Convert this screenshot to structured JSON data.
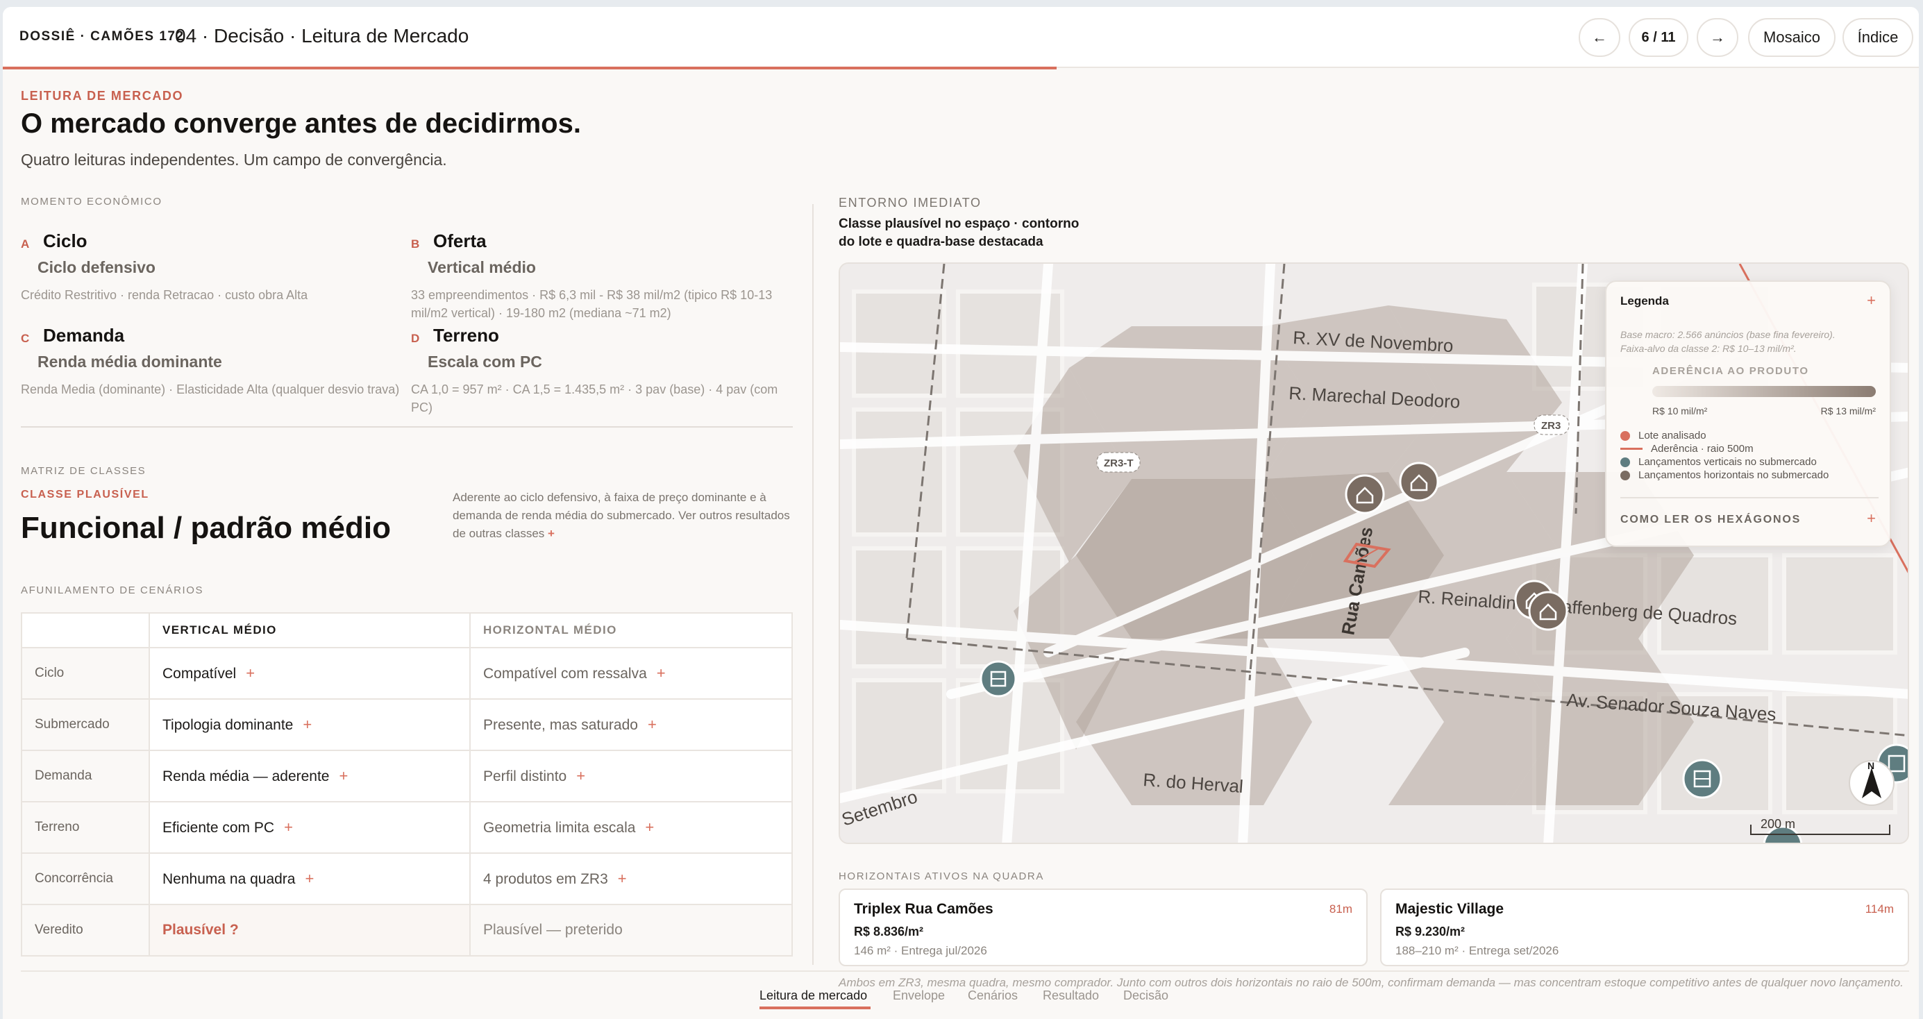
{
  "header": {
    "dossier": "DOSSIÊ · CAMÕES 172",
    "breadcrumb": "04 · Decisão · Leitura de Mercado",
    "prev": "←",
    "page": "6 / 11",
    "next": "→",
    "mosaic": "Mosaico",
    "index": "Índice",
    "progress": 0.55
  },
  "intro": {
    "eyebrow": "LEITURA DE MERCADO",
    "title": "O mercado converge antes de decidirmos.",
    "subtitle": "Quatro leituras independentes. Um campo de convergência."
  },
  "momento": {
    "label": "MOMENTO ECONÔMICO",
    "items": [
      {
        "letter": "A",
        "title": "Ciclo",
        "sub": "Ciclo defensivo",
        "desc": "Crédito Restritivo · renda Retracao · custo obra Alta"
      },
      {
        "letter": "B",
        "title": "Oferta",
        "sub": "Vertical médio",
        "desc": "33 empreendimentos · R$ 6,3 mil - R$ 38 mil/m2 (tipico R$ 10-13 mil/m2 vertical) · 19-180 m2 (mediana ~71 m2)"
      },
      {
        "letter": "C",
        "title": "Demanda",
        "sub": "Renda média dominante",
        "desc": "Renda Media (dominante) · Elasticidade Alta (qualquer desvio trava)"
      },
      {
        "letter": "D",
        "title": "Terreno",
        "sub": "Escala com PC",
        "desc": "CA 1,0 = 957 m² · CA 1,5 = 1.435,5 m² · 3 pav (base) · 4 pav (com PC)"
      }
    ]
  },
  "matriz": {
    "label": "MATRIZ DE CLASSES",
    "eyebrow": "CLASSE PLAUSÍVEL",
    "class_name": "Funcional / padrão médio",
    "note": "Aderente ao ciclo defensivo, à faixa de preço dominante e à demanda de renda média do submercado. Ver outros resultados de outras classes",
    "note_plus": "+"
  },
  "cenarios": {
    "label": "AFUNILAMENTO DE CENÁRIOS",
    "columns": [
      "",
      "VERTICAL MÉDIO",
      "HORIZONTAL MÉDIO"
    ],
    "plus": "+",
    "rows": [
      {
        "label": "Ciclo",
        "v": "Compatível",
        "h": "Compatível com ressalva"
      },
      {
        "label": "Submercado",
        "v": "Tipologia dominante",
        "h": "Presente, mas saturado"
      },
      {
        "label": "Demanda",
        "v": "Renda média — aderente",
        "h": "Perfil distinto"
      },
      {
        "label": "Terreno",
        "v": "Eficiente com PC",
        "h": "Geometria limita escala"
      },
      {
        "label": "Concorrência",
        "v": "Nenhuma na quadra",
        "h": "4 produtos em ZR3"
      },
      {
        "label": "Veredito",
        "v": "Plausível ?",
        "h": "Plausível — preterido"
      }
    ]
  },
  "entorno": {
    "label": "ENTORNO IMEDIATO",
    "caption_1": "Classe plausível no espaço · contorno",
    "caption_2": "do lote e quadra-base destacada"
  },
  "map": {
    "streets": {
      "xv": "R. XV de Novembro",
      "marechal": "R. Marechal Deodoro",
      "camoes": "Rua Camões",
      "reinaldino": "R. Reinaldino Schaffenberg de Quadros",
      "senador": "Av. Senador Souza Naves",
      "herval": "R. do Herval",
      "setembro": "Setembro"
    },
    "zones": {
      "zr3t": "ZR3-T",
      "zr3": "ZR3"
    },
    "scale": "200 m",
    "north": "N",
    "colors": {
      "hex": "#b3a69c",
      "lot": "#d9705e",
      "vertical": "#5f7d80",
      "horizontal": "#7a6c62"
    }
  },
  "legend": {
    "title": "Legenda",
    "plus": "+",
    "base_1": "Base macro: 2.566 anúncios (base fina fevereiro).",
    "base_2": "Faixa-alvo da classe 2: R$ 10–13 mil/m².",
    "aderencia": "ADERÊNCIA AO PRODUTO",
    "range_min": "R$ 10 mil/m²",
    "range_max": "R$ 13 mil/m²",
    "items": [
      "Lote analisado",
      "Aderência · raio 500m",
      "Lançamentos verticais no submercado",
      "Lançamentos horizontais no submercado"
    ],
    "how": "COMO LER OS HEXÁGONOS"
  },
  "horizontais": {
    "label": "HORIZONTAIS ATIVOS NA QUADRA",
    "cards": [
      {
        "title": "Triplex Rua Camões",
        "dist": "81m",
        "price": "R$ 8.836/m²",
        "meta": "146 m² · Entrega jul/2026"
      },
      {
        "title": "Majestic Village",
        "dist": "114m",
        "price": "R$ 9.230/m²",
        "meta": "188–210 m² · Entrega set/2026"
      }
    ],
    "footnote": "Ambos em ZR3, mesma quadra, mesmo comprador. Junto com outros dois horizontais no raio de 500m, confirmam demanda — mas concentram estoque competitivo antes de qualquer novo lançamento."
  },
  "bottom_tabs": [
    "Leitura de mercado",
    "Envelope",
    "Cenários",
    "Resultado",
    "Decisão"
  ]
}
